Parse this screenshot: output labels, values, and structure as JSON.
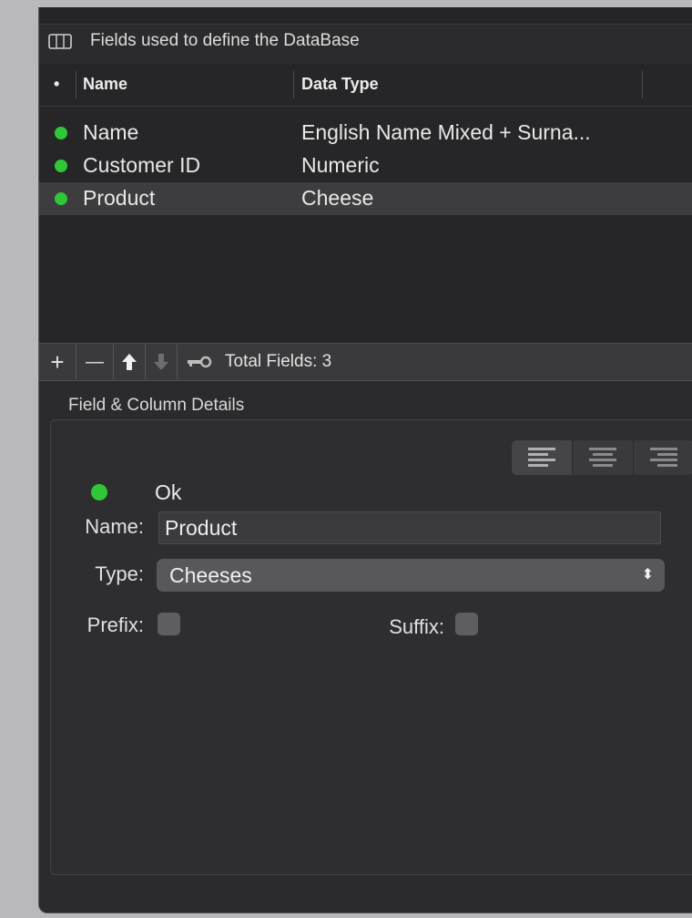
{
  "header": {
    "title": "Fields used to define the DataBase",
    "icon": "columns-icon"
  },
  "table": {
    "columns": {
      "status": "•",
      "name": "Name",
      "type": "Data Type"
    },
    "rows": [
      {
        "name": "Name",
        "type": "English Name Mixed + Surna...",
        "status_color": "#2fc737",
        "selected": false
      },
      {
        "name": "Customer ID",
        "type": "Numeric",
        "status_color": "#2fc737",
        "selected": false
      },
      {
        "name": "Product",
        "type": "Cheese",
        "status_color": "#2fc737",
        "selected": true
      }
    ]
  },
  "toolbar": {
    "add_label": "+",
    "remove_label": "—",
    "move_up_icon": "arrow-up-icon",
    "move_down_icon": "arrow-down-icon",
    "key_icon": "key-icon",
    "total_label": "Total Fields: 3"
  },
  "details": {
    "title": "Field & Column Details",
    "alignment": {
      "options": [
        "left",
        "center",
        "right"
      ],
      "selected": "left"
    },
    "status_text": "Ok",
    "status_color": "#2fc737",
    "name_label": "Name:",
    "name_value": "Product",
    "type_label": "Type:",
    "type_value": "Cheeses",
    "prefix_label": "Prefix:",
    "prefix_checked": false,
    "suffix_label": "Suffix:",
    "suffix_checked": false
  }
}
